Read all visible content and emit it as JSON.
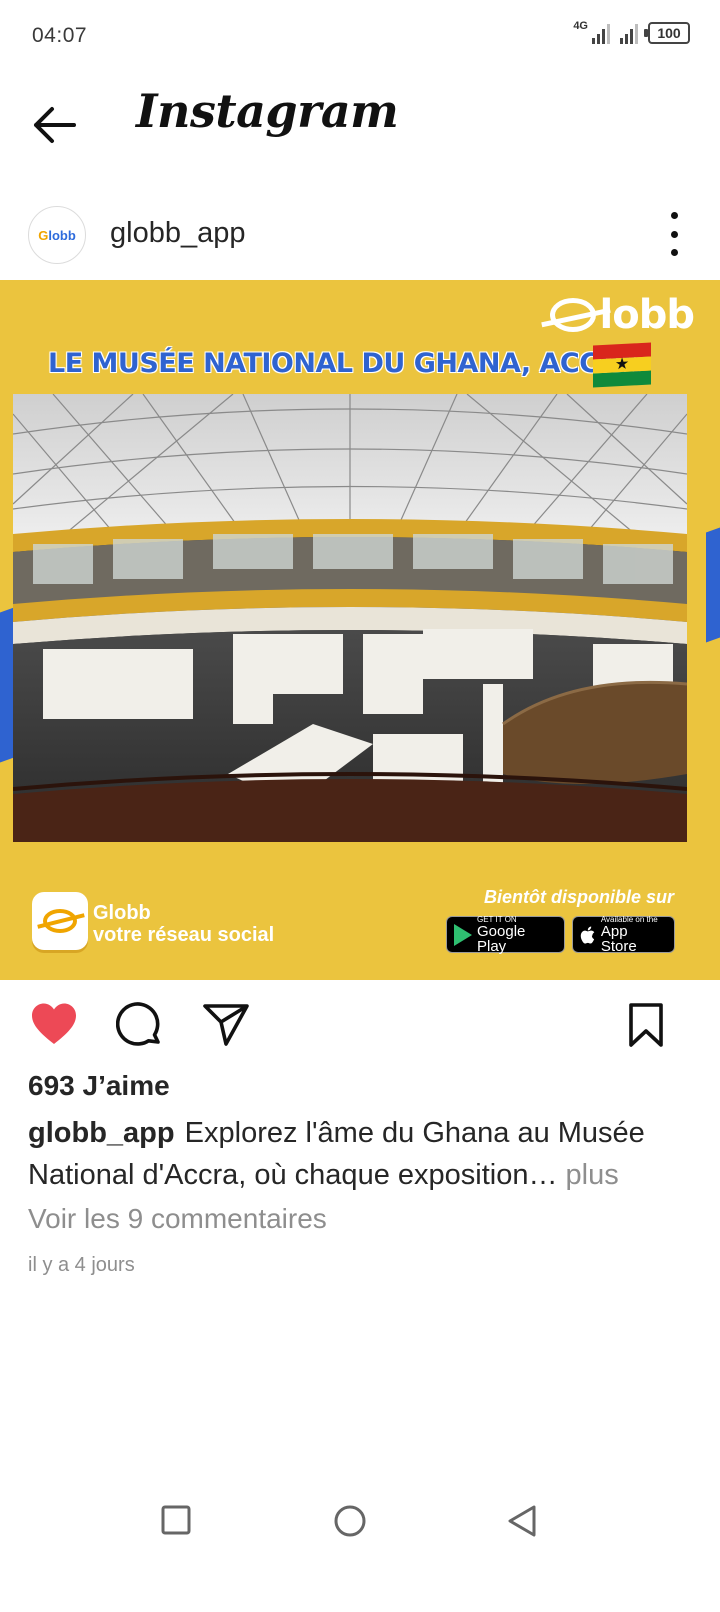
{
  "status": {
    "time": "04:07",
    "network_label": "4G",
    "battery": "100"
  },
  "header": {
    "title": "Instagram",
    "back_icon": "arrow-left-icon"
  },
  "post": {
    "username": "globb_app",
    "avatar_text_g": "G",
    "avatar_text_rest": "lobb",
    "more_icon": "more-vertical-icon"
  },
  "image": {
    "brand_logo": "lobb",
    "headline": "LE MUSÉE NATIONAL DU GHANA, ACCRA",
    "flag_star": "★",
    "footer_brand": "Globb",
    "footer_tagline": "votre réseau social",
    "footer_soon": "Bientôt disponible sur",
    "google_play_small": "GET IT ON",
    "google_play_big": "Google Play",
    "app_store_small": "Available on the",
    "app_store_big": "App Store",
    "apple_glyph": ""
  },
  "actions": {
    "like_icon": "heart-filled-icon",
    "comment_icon": "comment-icon",
    "share_icon": "send-icon",
    "save_icon": "bookmark-icon",
    "like_color": "#ed4956"
  },
  "engagement": {
    "likes": "693 J’aime",
    "caption_user": "globb_app",
    "caption_text": "Explorez l'âme du Ghana au Musée National d'Accra, où chaque exposition…",
    "caption_more": "plus",
    "comments_link": "Voir les 9 commentaires",
    "timestamp": "il y a 4 jours"
  },
  "navbar": {
    "recent_icon": "square-icon",
    "home_icon": "circle-icon",
    "back_icon": "triangle-back-icon"
  },
  "colors": {
    "banner_yellow": "#ebc43e",
    "brand_blue": "#2f63d0",
    "text_primary": "#262626",
    "text_secondary": "#8e8e8e"
  }
}
